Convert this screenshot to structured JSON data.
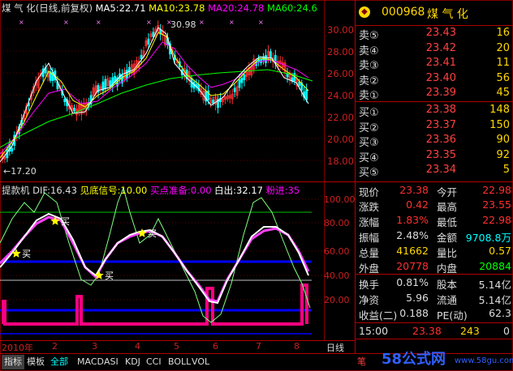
{
  "header": {
    "title": "煤 气 化(日线,前复权)",
    "ma5": "MA5:22.71",
    "ma10": "MA10:23.78",
    "ma20": "MA20:24.78",
    "ma60": "MA60:24.6"
  },
  "main_chart": {
    "y_ticks": [
      "30.00",
      "28.00",
      "26.00",
      "24.00",
      "22.00",
      "20.00",
      "18.00"
    ],
    "high_label": "30.98",
    "low_label": "←17.20"
  },
  "indicator": {
    "name": "提款机",
    "dif": "DIF:16.43",
    "signal": "见底信号:10.00",
    "buy_prep": "买点准备:0.00",
    "exit": "白出:32.17",
    "add": "粉进:35",
    "y_ticks": [
      "100.00",
      "80.00",
      "60.00",
      "40.00",
      "20.00"
    ],
    "buy_label": "买",
    "buy_markers": 4
  },
  "date_axis": {
    "labels": [
      "2010年",
      "2",
      "3",
      "4",
      "5",
      "6",
      "7",
      "8"
    ],
    "period": "日线"
  },
  "quote": {
    "code": "000968",
    "name": "煤 气 化",
    "asks": [
      {
        "label": "卖⑤",
        "price": "23.43",
        "vol": "16"
      },
      {
        "label": "卖④",
        "price": "23.42",
        "vol": "20"
      },
      {
        "label": "卖③",
        "price": "23.41",
        "vol": "11"
      },
      {
        "label": "卖②",
        "price": "23.40",
        "vol": "56"
      },
      {
        "label": "卖①",
        "price": "23.39",
        "vol": "45"
      }
    ],
    "bids": [
      {
        "label": "买①",
        "price": "23.38",
        "vol": "148"
      },
      {
        "label": "买②",
        "price": "23.37",
        "vol": "150"
      },
      {
        "label": "买③",
        "price": "23.36",
        "vol": "90"
      },
      {
        "label": "买④",
        "price": "23.35",
        "vol": "92"
      },
      {
        "label": "买⑤",
        "price": "23.34",
        "vol": "5"
      }
    ],
    "stats": [
      {
        "l1": "现价",
        "v1": "23.38",
        "l2": "今开",
        "v2": "22.98"
      },
      {
        "l1": "涨跌",
        "v1": "0.42",
        "l2": "最高",
        "v2": "23.55"
      },
      {
        "l1": "涨幅",
        "v1": "1.83%",
        "l2": "最低",
        "v2": "22.98"
      },
      {
        "l1": "振幅",
        "v1": "2.48%",
        "l2": "金额",
        "v2": "9708.8万"
      },
      {
        "l1": "总量",
        "v1": "41662",
        "l2": "量比",
        "v2": "0.57"
      },
      {
        "l1": "外盘",
        "v1": "20778",
        "l2": "内盘",
        "v2": "20884"
      },
      {
        "l1": "换手",
        "v1": "0.81%",
        "l2": "股本",
        "v2": "5.14亿"
      },
      {
        "l1": "净资",
        "v1": "5.96",
        "l2": "流通",
        "v2": "5.14亿"
      },
      {
        "l1": "收益(二)",
        "v1": "0.188",
        "l2": "PE(动)",
        "v2": "62.3"
      }
    ],
    "tick": {
      "time": "15:00",
      "price": "23.38",
      "vol": "243",
      "flag": "0"
    }
  },
  "tabs": [
    "指标",
    "模板",
    "全部",
    "MACD",
    "ASI",
    "KDJ",
    "CCI",
    "BOLL",
    "VOL"
  ],
  "watermark": {
    "brand": "58公式网",
    "url": "www.58gu.com",
    "side": "笔"
  },
  "colors": {
    "up": "#ff3030",
    "down": "#00ffff",
    "ma5": "#ffffff",
    "ma10": "#ffff00",
    "ma20": "#ff00ff",
    "ma60": "#00ff00",
    "grid": "#800000",
    "blue": "#0000ff",
    "pink": "#ff0080"
  }
}
